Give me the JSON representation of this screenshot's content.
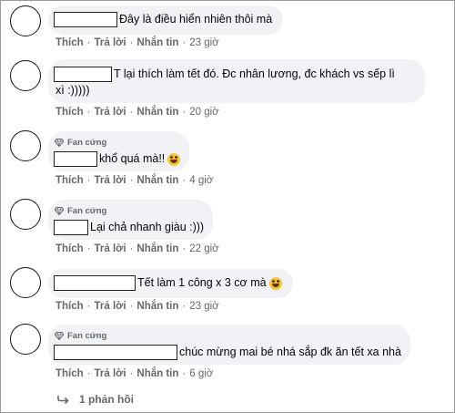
{
  "comments": [
    {
      "badge": "",
      "text": "Đây là điều hiển nhiên thôi mà",
      "like": "Thích",
      "reply": "Trả lời",
      "message": "Nhắn tin",
      "time": "23 giờ"
    },
    {
      "badge": "",
      "text": "T lại thích làm tết đó. Đc nhân lương, đc khách vs sếp lì xì :)))))",
      "text_line1": "T lại thích làm tết đó. Đc nhân lương, đc khách vs sếp lì",
      "text_line2": "xì :)))))",
      "like": "Thích",
      "reply": "Trả lời",
      "message": "Nhắn tin",
      "time": "20 giờ"
    },
    {
      "badge": "Fan cứng",
      "text": "khổ quá mà!!",
      "emoji": "laughing-emoji",
      "like": "Thích",
      "reply": "Trả lời",
      "message": "Nhắn tin",
      "time": "4 giờ"
    },
    {
      "badge": "Fan cứng",
      "text": "Lại chả nhanh giàu :)))",
      "like": "Thích",
      "reply": "Trả lời",
      "message": "Nhắn tin",
      "time": "22 giờ"
    },
    {
      "badge": "",
      "text": "Tết làm 1 công x 3 cơ mà",
      "emoji": "laughing-emoji",
      "like": "Thích",
      "reply": "Trả lời",
      "message": "Nhắn tin",
      "time": "23 giờ"
    },
    {
      "badge": "Fan cứng",
      "text": "chúc mừng mai bé nhá sắp đk ăn tết xa nhà",
      "like": "Thích",
      "reply": "Trả lời",
      "message": "Nhắn tin",
      "time": "6 giờ"
    }
  ],
  "replies_link": "1 phản hồi",
  "colors": {
    "bubble": "#f0f2f5",
    "meta": "#65676b",
    "text": "#050505"
  }
}
